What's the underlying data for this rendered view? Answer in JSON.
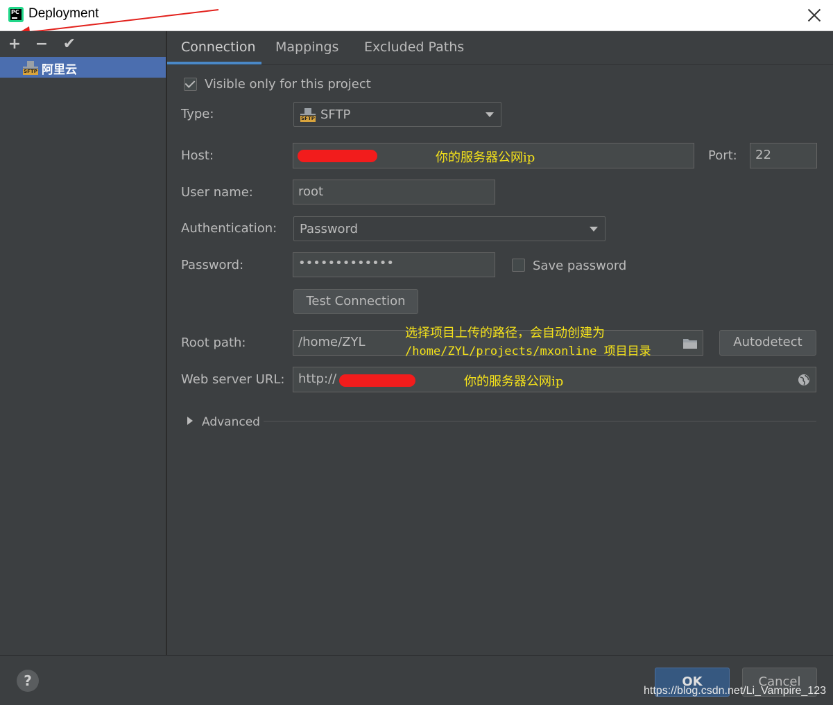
{
  "window": {
    "title": "Deployment",
    "logo_text": "PC"
  },
  "toolbar": {
    "add": "+",
    "remove": "−",
    "apply": "✔"
  },
  "servers": [
    {
      "name": "阿里云",
      "type_label": "SFTP"
    }
  ],
  "tabs": [
    {
      "label": "Connection",
      "active": true
    },
    {
      "label": "Mappings",
      "active": false
    },
    {
      "label": "Excluded Paths",
      "active": false
    }
  ],
  "connection": {
    "visible_only_label": "Visible only for this project",
    "visible_only_checked": true,
    "type_label": "Type:",
    "type_value": "SFTP",
    "host_label": "Host:",
    "host_annotation": "你的服务器公网ip",
    "port_label": "Port:",
    "port_value": "22",
    "user_label": "User name:",
    "user_value": "root",
    "auth_label": "Authentication:",
    "auth_value": "Password",
    "password_label": "Password:",
    "password_value": "•••••••••••••",
    "save_password_label": "Save password",
    "save_password_checked": false,
    "test_button": "Test Connection",
    "root_label": "Root path:",
    "root_value": "/home/ZYL",
    "root_annotation_1": "选择项目上传的路径，会自动创建为",
    "root_annotation_2": "/home/ZYL/projects/mxonline 项目目录",
    "autodetect_button": "Autodetect",
    "web_label": "Web server URL:",
    "web_value": "http://",
    "web_annotation": "你的服务器公网ip",
    "advanced_label": "Advanced"
  },
  "footer": {
    "help": "?",
    "ok": "OK",
    "cancel": "Cancel",
    "watermark": "https://blog.csdn.net/Li_Vampire_123"
  },
  "colors": {
    "accent": "#4a88c7",
    "selection": "#4b6eaf",
    "annotation": "#f5e21a",
    "redaction": "#f21c1c"
  }
}
